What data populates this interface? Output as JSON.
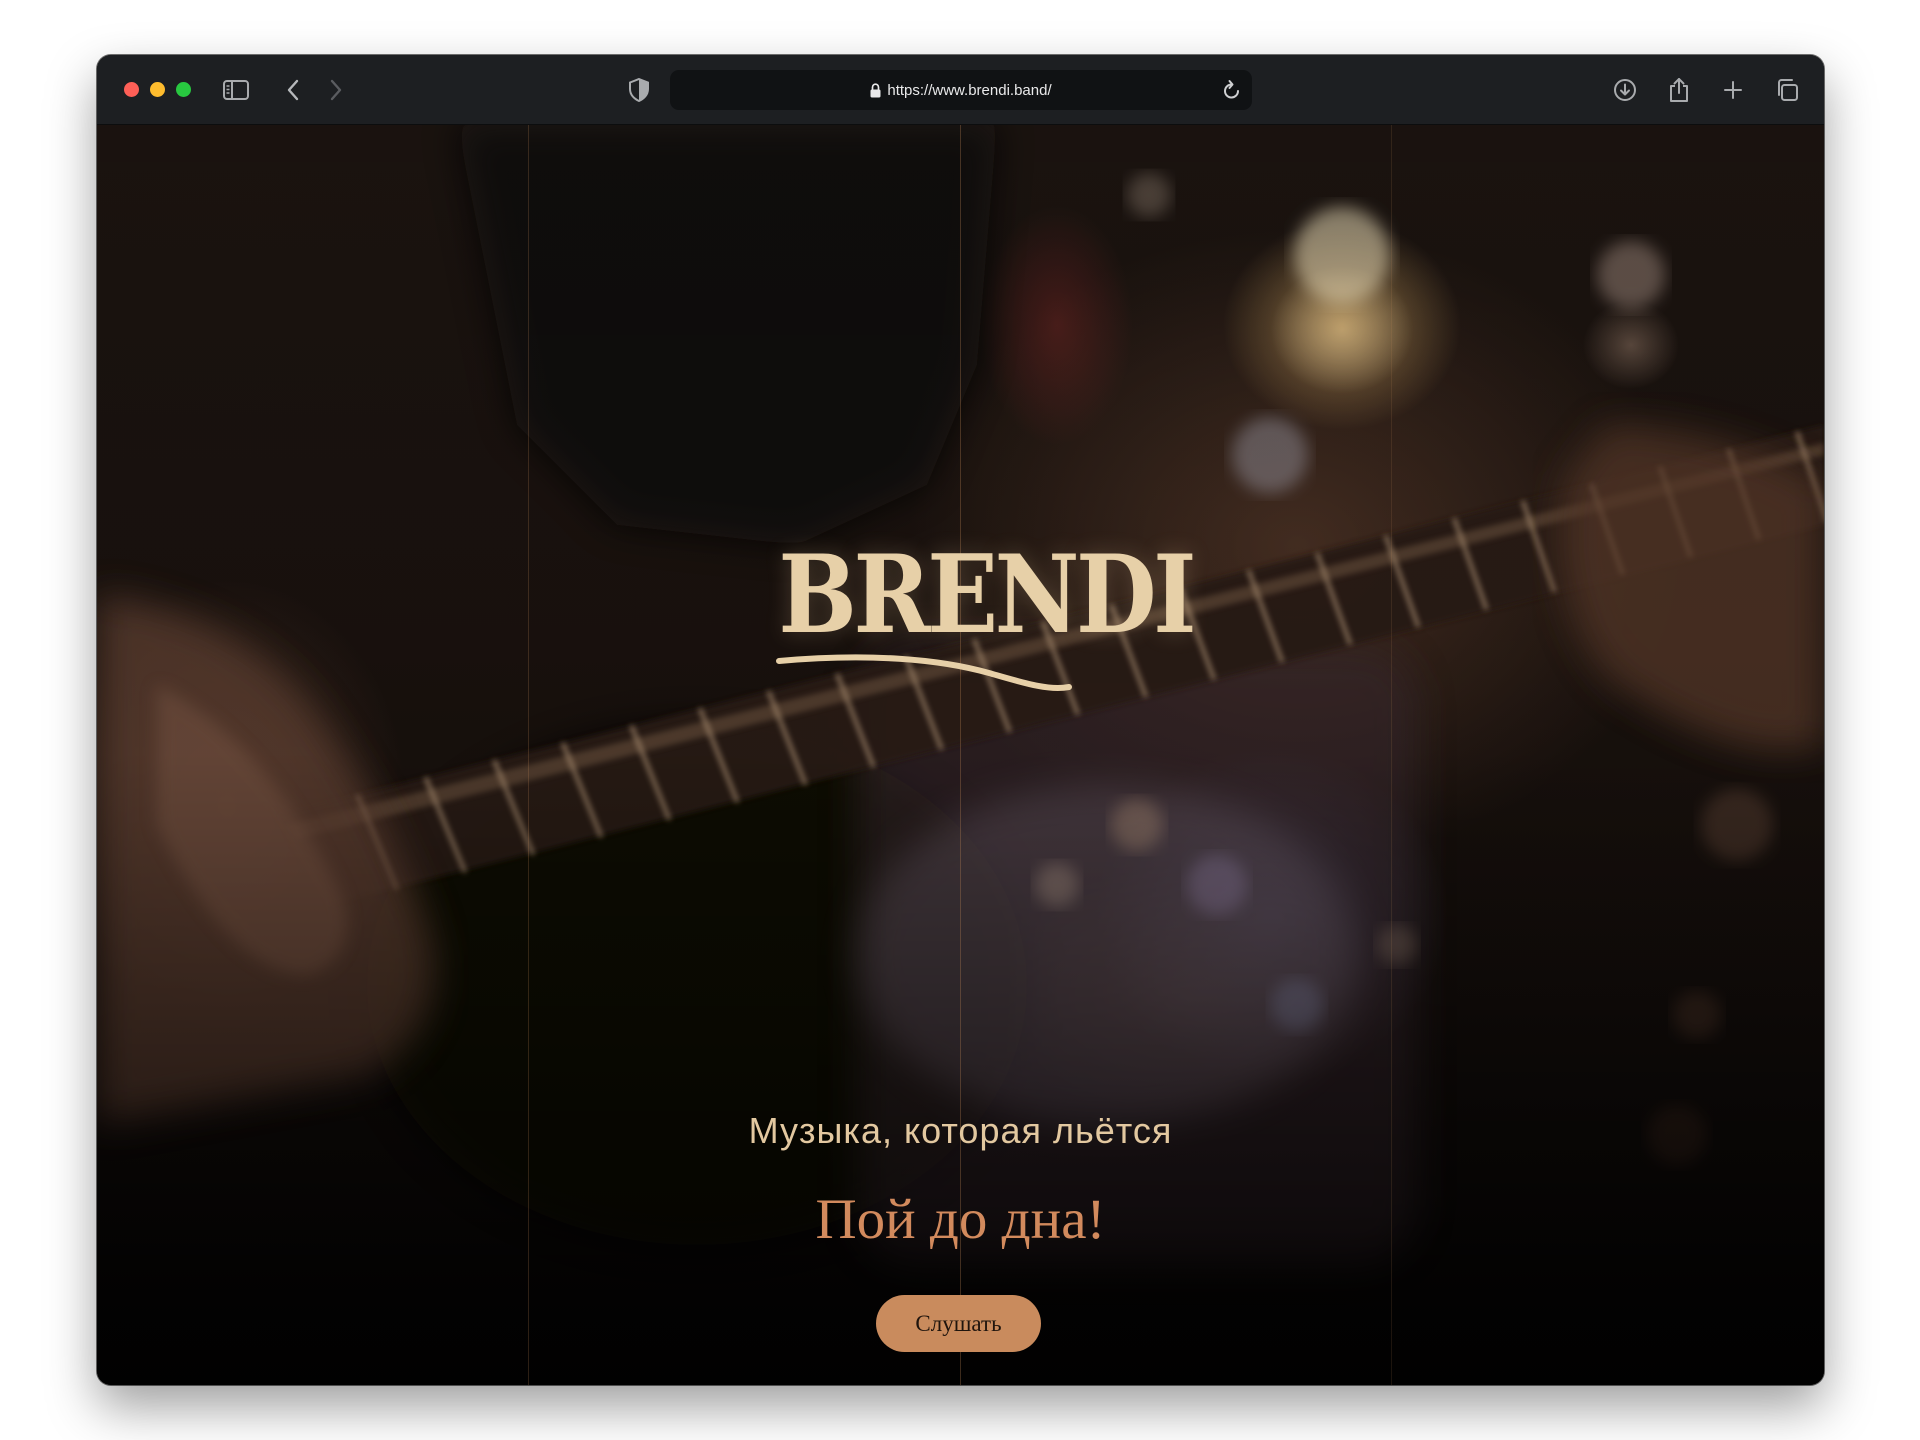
{
  "browser": {
    "url": "https://www.brendi.band/"
  },
  "hero": {
    "logo_text": "BRENDI",
    "tagline": "Музыка, которая льётся",
    "slogan": "Пой до дна!",
    "listen_label": "Слушать"
  },
  "colors": {
    "logo": "#e7d0a8",
    "tagline": "#e3c8a0",
    "slogan": "#d28a5d",
    "button": "#c98b5d",
    "toolbar": "#1d1f22"
  }
}
